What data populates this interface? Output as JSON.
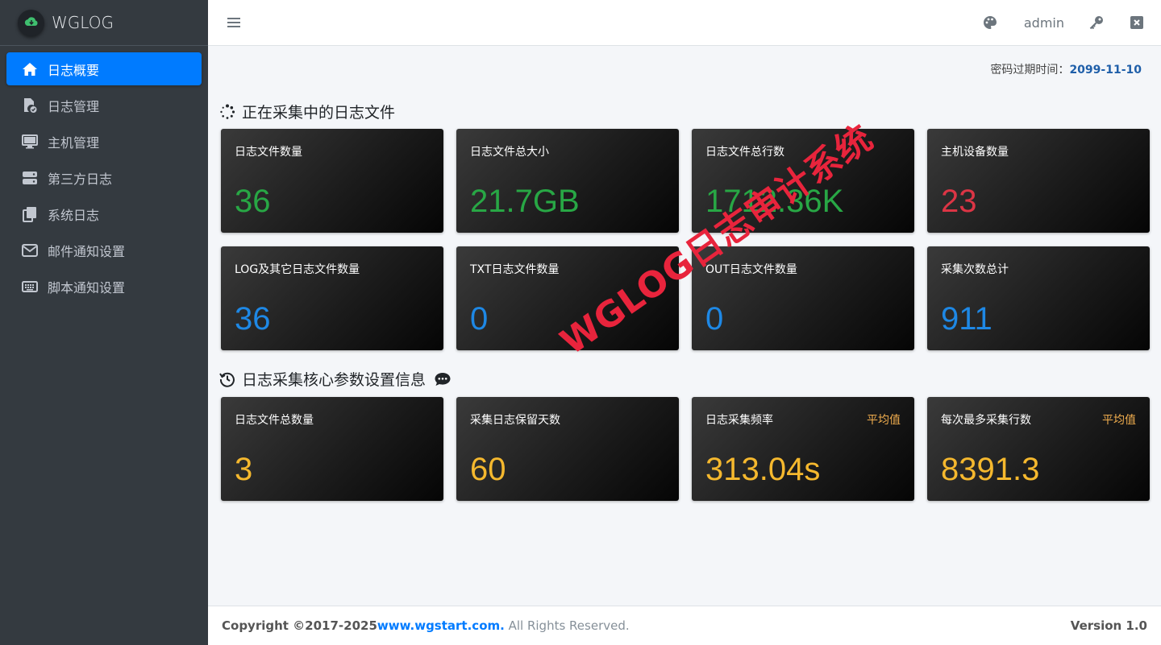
{
  "brand": {
    "name": "WGLOG"
  },
  "sidebar": {
    "items": [
      {
        "label": "日志概要",
        "icon": "home-icon",
        "active": true
      },
      {
        "label": "日志管理",
        "icon": "file-check-icon"
      },
      {
        "label": "主机管理",
        "icon": "monitor-icon"
      },
      {
        "label": "第三方日志",
        "icon": "server-icon"
      },
      {
        "label": "系统日志",
        "icon": "copy-icon"
      },
      {
        "label": "邮件通知设置",
        "icon": "envelope-icon"
      },
      {
        "label": "脚本通知设置",
        "icon": "keyboard-icon"
      }
    ]
  },
  "header": {
    "menu_icon": "bars-icon",
    "username": "admin"
  },
  "password_expiry": {
    "label": "密码过期时间：",
    "date": "2099-11-10"
  },
  "sections": {
    "collecting": {
      "title": "正在采集中的日志文件"
    },
    "core_params": {
      "title": "日志采集核心参数设置信息"
    }
  },
  "cards_row1": [
    {
      "label": "日志文件数量",
      "value": "36"
    },
    {
      "label": "日志文件总大小",
      "value": "21.7GB"
    },
    {
      "label": "日志文件总行数",
      "value": "1712.36K"
    },
    {
      "label": "主机设备数量",
      "value": "23"
    }
  ],
  "cards_row2": [
    {
      "label": "LOG及其它日志文件数量",
      "value": "36"
    },
    {
      "label": "TXT日志文件数量",
      "value": "0"
    },
    {
      "label": "OUT日志文件数量",
      "value": "0"
    },
    {
      "label": "采集次数总计",
      "value": "911"
    }
  ],
  "cards_row3": [
    {
      "label": "日志文件总数量",
      "value": "3",
      "tag": ""
    },
    {
      "label": "采集日志保留天数",
      "value": "60",
      "tag": ""
    },
    {
      "label": "日志采集频率",
      "value": "313.04s",
      "tag": "平均值"
    },
    {
      "label": "每次最多采集行数",
      "value": "8391.3",
      "tag": "平均值"
    }
  ],
  "watermark": "WGLOG日志审计系统",
  "footer": {
    "copyright": "Copyright ©2017-2025 ",
    "site": "www.wgstart.com.",
    "rights": " All Rights Reserved.",
    "version": "Version 1.0"
  },
  "colors": {
    "sidebar_bg": "#343a40",
    "active": "#007bff",
    "green": "#28a745",
    "red": "#dc3545",
    "blue": "#1e88e5",
    "yellow": "#f5b82e",
    "tag": "#f0ad4e",
    "watermark": "#e8243c"
  }
}
